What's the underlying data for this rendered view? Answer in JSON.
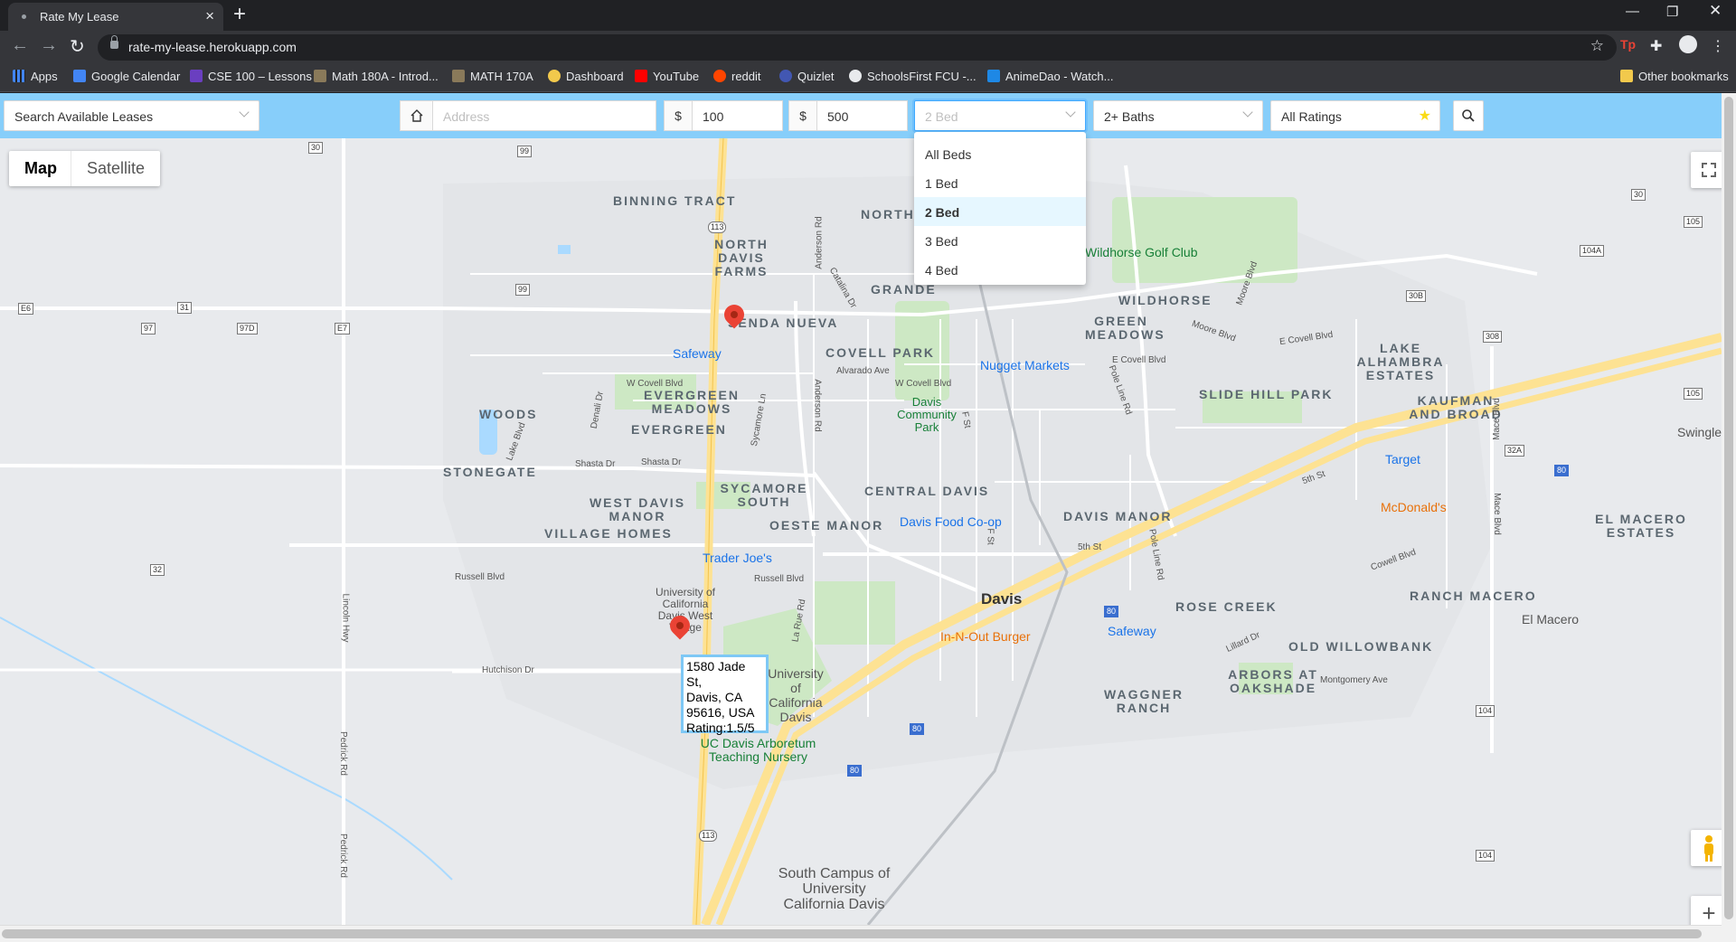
{
  "browser": {
    "tab_title": "Rate My Lease",
    "url": "rate-my-lease.herokuapp.com",
    "bookmarks": [
      "Apps",
      "Google Calendar",
      "CSE 100 – Lessons",
      "Math 180A - Introd...",
      "MATH 170A",
      "Dashboard",
      "YouTube",
      "reddit",
      "Quizlet",
      "SchoolsFirst FCU -...",
      "AnimeDao - Watch..."
    ],
    "other_bookmarks": "Other bookmarks"
  },
  "filters": {
    "search_leases": "Search Available Leases",
    "address_placeholder": "Address",
    "currency": "$",
    "min_price": "100",
    "max_price": "500",
    "beds_selected": "2 Bed",
    "baths_selected": "2+ Baths",
    "ratings_selected": "All Ratings",
    "bed_options": [
      "All Beds",
      "1 Bed",
      "2 Bed",
      "3 Bed",
      "4 Bed"
    ]
  },
  "map": {
    "map_label": "Map",
    "satellite_label": "Satellite",
    "info_window": {
      "line1": "1580 Jade St,",
      "line2": "Davis, CA",
      "line3": "95616, USA",
      "line4": "Rating:1.5/5"
    },
    "areas": [
      "BINNING TRACT",
      "NORTH DAVIS FARMS",
      "SENDA NUEVA",
      "GRANDE",
      "COVELL PARK",
      "WILDHORSE",
      "GREEN MEADOWS",
      "LAKE ALHAMBRA ESTATES",
      "SLIDE HILL PARK",
      "KAUFMAN AND BROAD",
      "EVERGREEN MEADOWS",
      "EVERGREEN",
      "WOODS",
      "STONEGATE",
      "WEST DAVIS MANOR",
      "SYCAMORE SOUTH",
      "CENTRAL DAVIS",
      "OESTE MANOR",
      "VILLAGE HOMES",
      "DAVIS MANOR",
      "EL MACERO ESTATES",
      "RANCH MACERO",
      "ROSE CREEK",
      "OLD WILLOWBANK",
      "ARBORS AT OAKSHADE",
      "WAGGNER RANCH",
      "NORTH"
    ],
    "pois": {
      "safeway1": "Safeway",
      "nugget": "Nugget Markets",
      "wildhorse_golf": "Wildhorse Golf Club",
      "davis_park": "Davis Community Park",
      "target": "Target",
      "mcdonalds": "McDonald's",
      "food_coop": "Davis Food Co-op",
      "trader_joes": "Trader Joe's",
      "in_n_out": "In-N-Out Burger",
      "safeway2": "Safeway",
      "arboretum": "UC Davis Arboretum Teaching Nursery",
      "uc_west": "University of California Davis West Village",
      "uc_main": "University of California Davis",
      "south_campus": "South Campus of University California Davis",
      "el_macero": "El Macero",
      "swingle": "Swingle"
    },
    "city": "Davis",
    "streets": {
      "covell_w": "W Covell Blvd",
      "covell_e": "E Covell Blvd",
      "russell": "Russell Blvd",
      "hutchison": "Hutchison Dr",
      "fifth": "5th St",
      "fifth_e": "5th St",
      "alvarado": "Alvarado Ave",
      "anderson": "Anderson Rd",
      "anderson2": "Anderson Rd",
      "sycamore": "Sycamore Ln",
      "lake": "Lake Blvd",
      "shasta": "Shasta Dr",
      "shasta2": "Shasta Dr",
      "denali": "Denali Dr",
      "catalina": "Catalina Dr",
      "pole_line": "Pole Line Rd",
      "pole_line2": "Pole Line Rd",
      "mace": "Mace Blvd",
      "mace2": "Mace Blvd",
      "moore": "Moore Blvd",
      "moore2": "Moore Blvd",
      "montgomery": "Montgomery Ave",
      "lillard": "Lillard Dr",
      "cowell": "Cowell Blvd",
      "la_rue": "La Rue Rd",
      "lincoln": "Lincoln Hwy",
      "pedrick": "Pedrick Rd",
      "pedrick2": "Pedrick Rd",
      "f_st": "F St",
      "f_st2": "F St"
    },
    "shields": [
      "30",
      "99",
      "113",
      "E6",
      "31",
      "97",
      "97D",
      "E7",
      "99",
      "32",
      "30",
      "105",
      "104A",
      "30B",
      "308",
      "105",
      "32A",
      "80",
      "80",
      "80",
      "80",
      "104",
      "104",
      "113"
    ]
  }
}
